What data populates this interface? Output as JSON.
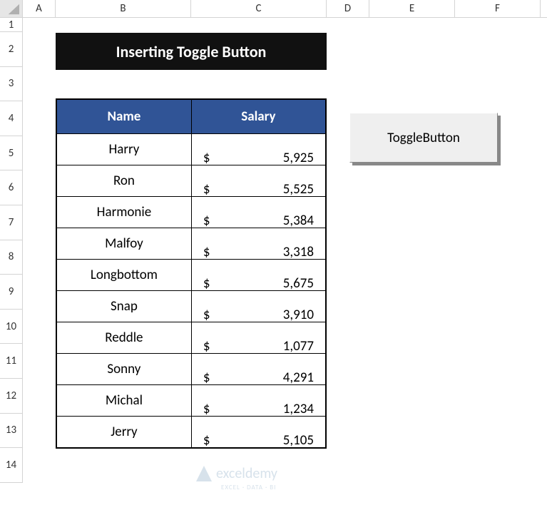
{
  "columns": [
    {
      "letter": "A",
      "width": 46
    },
    {
      "letter": "B",
      "width": 190
    },
    {
      "letter": "C",
      "width": 190
    },
    {
      "letter": "D",
      "width": 60
    },
    {
      "letter": "E",
      "width": 120
    },
    {
      "letter": "F",
      "width": 120
    }
  ],
  "row_heights": {
    "1": 20,
    "default": 48
  },
  "title": "Inserting Toggle Button",
  "headers": {
    "name": "Name",
    "salary": "Salary"
  },
  "currency_symbol": "$",
  "rows": [
    {
      "name": "Harry",
      "salary": "5,925"
    },
    {
      "name": "Ron",
      "salary": "5,525"
    },
    {
      "name": "Harmonie",
      "salary": "5,384"
    },
    {
      "name": "Malfoy",
      "salary": "3,318"
    },
    {
      "name": "Longbottom",
      "salary": "5,675"
    },
    {
      "name": "Snap",
      "salary": "3,910"
    },
    {
      "name": "Reddle",
      "salary": "1,077"
    },
    {
      "name": "Sonny",
      "salary": "4,291"
    },
    {
      "name": "Michal",
      "salary": "1,234"
    },
    {
      "name": "Jerry",
      "salary": "5,105"
    }
  ],
  "toggle_label": "ToggleButton",
  "watermark": {
    "main": "exceldemy",
    "sub": "EXCEL · DATA · BI"
  },
  "colors": {
    "header_bg": "#305496",
    "title_bg": "#111111"
  },
  "chart_data": {
    "type": "table",
    "columns": [
      "Name",
      "Salary"
    ],
    "data": [
      [
        "Harry",
        5925
      ],
      [
        "Ron",
        5525
      ],
      [
        "Harmonie",
        5384
      ],
      [
        "Malfoy",
        3318
      ],
      [
        "Longbottom",
        5675
      ],
      [
        "Snap",
        3910
      ],
      [
        "Reddle",
        1077
      ],
      [
        "Sonny",
        4291
      ],
      [
        "Michal",
        1234
      ],
      [
        "Jerry",
        5105
      ]
    ]
  }
}
